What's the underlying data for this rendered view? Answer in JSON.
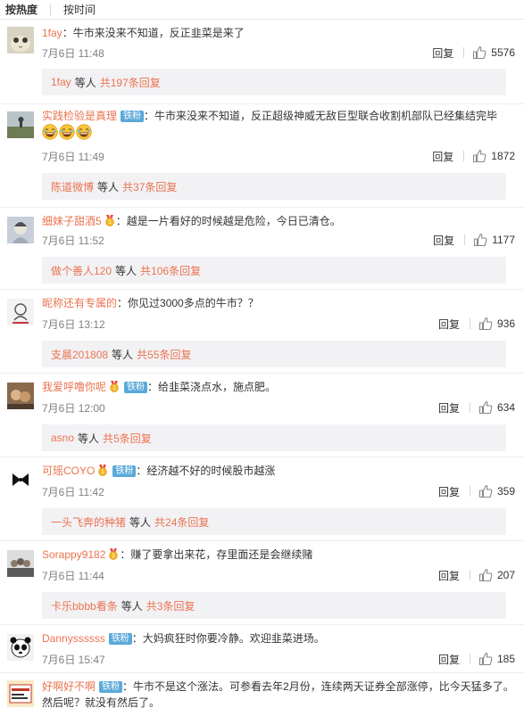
{
  "sort": {
    "hot": "按热度",
    "time": "按时间"
  },
  "labels": {
    "reply": "回复",
    "fan_badge": "铁粉",
    "others": "等人",
    "total_prefix": "共",
    "total_suffix": "条回复",
    "colon": "："
  },
  "comments": [
    {
      "user": "1fay",
      "text": "牛市来没来不知道，反正韭菜是来了",
      "time": "7月6日 11:48",
      "likes": "5576",
      "sub_user": "1fay",
      "sub_count": "197"
    },
    {
      "user": "实践检验是真理",
      "text": "牛市来没来不知道，反正超级神威无敌巨型联合收割机部队已经集结完毕",
      "time": "7月6日 11:49",
      "likes": "1872",
      "sub_user": "陈道微博",
      "sub_count": "37"
    },
    {
      "user": "细妹子甜酒5",
      "text": "越是一片看好的时候越是危险，今日已清仓。",
      "time": "7月6日 11:52",
      "likes": "1177",
      "sub_user": "做个善人120",
      "sub_count": "106"
    },
    {
      "user": "昵称还有专属的",
      "text": "你见过3000多点的牛市？？",
      "time": "7月6日 13:12",
      "likes": "936",
      "sub_user": "支晨201808",
      "sub_count": "55"
    },
    {
      "user": "我爱呼噜你呢",
      "text": "给韭菜浇点水，施点肥。",
      "time": "7月6日 12:00",
      "likes": "634",
      "sub_user": "asno",
      "sub_count": "5"
    },
    {
      "user": "可瑶COYO",
      "text": "经济越不好的时候股市越涨",
      "time": "7月6日 11:42",
      "likes": "359",
      "sub_user": "一头飞奔的种猪",
      "sub_count": "24"
    },
    {
      "user": "Sorappy9182",
      "text": "赚了要拿出来花，存里面还是会继续赌",
      "time": "7月6日 11:44",
      "likes": "207",
      "sub_user": "卡乐bbbb看条",
      "sub_count": "3"
    },
    {
      "user": "Dannyssssss",
      "text": "大妈疯狂时你要冷静。欢迎韭菜进场。",
      "time": "7月6日 15:47",
      "likes": "185"
    },
    {
      "user": "好啊好不啊",
      "text": "牛市不是这个涨法。可参看去年2月份，连续两天证券全部涨停，比今天猛多了。然后呢？就没有然后了。"
    }
  ]
}
